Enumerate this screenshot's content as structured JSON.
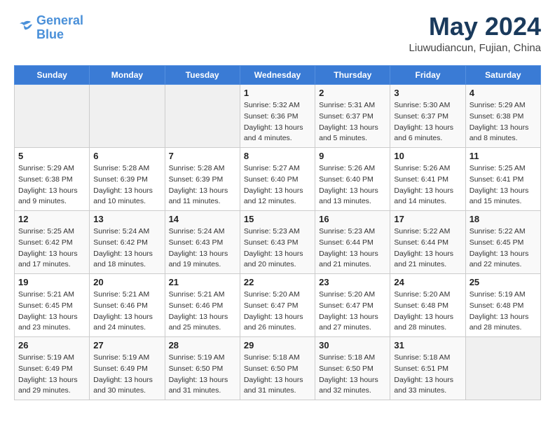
{
  "header": {
    "logo_line1": "General",
    "logo_line2": "Blue",
    "month_year": "May 2024",
    "location": "Liuwudiancun, Fujian, China"
  },
  "weekdays": [
    "Sunday",
    "Monday",
    "Tuesday",
    "Wednesday",
    "Thursday",
    "Friday",
    "Saturday"
  ],
  "weeks": [
    [
      {
        "day": "",
        "empty": true
      },
      {
        "day": "",
        "empty": true
      },
      {
        "day": "",
        "empty": true
      },
      {
        "day": "1",
        "sunrise": "5:32 AM",
        "sunset": "6:36 PM",
        "daylight": "13 hours and 4 minutes."
      },
      {
        "day": "2",
        "sunrise": "5:31 AM",
        "sunset": "6:37 PM",
        "daylight": "13 hours and 5 minutes."
      },
      {
        "day": "3",
        "sunrise": "5:30 AM",
        "sunset": "6:37 PM",
        "daylight": "13 hours and 6 minutes."
      },
      {
        "day": "4",
        "sunrise": "5:29 AM",
        "sunset": "6:38 PM",
        "daylight": "13 hours and 8 minutes."
      }
    ],
    [
      {
        "day": "5",
        "sunrise": "5:29 AM",
        "sunset": "6:38 PM",
        "daylight": "13 hours and 9 minutes."
      },
      {
        "day": "6",
        "sunrise": "5:28 AM",
        "sunset": "6:39 PM",
        "daylight": "13 hours and 10 minutes."
      },
      {
        "day": "7",
        "sunrise": "5:28 AM",
        "sunset": "6:39 PM",
        "daylight": "13 hours and 11 minutes."
      },
      {
        "day": "8",
        "sunrise": "5:27 AM",
        "sunset": "6:40 PM",
        "daylight": "13 hours and 12 minutes."
      },
      {
        "day": "9",
        "sunrise": "5:26 AM",
        "sunset": "6:40 PM",
        "daylight": "13 hours and 13 minutes."
      },
      {
        "day": "10",
        "sunrise": "5:26 AM",
        "sunset": "6:41 PM",
        "daylight": "13 hours and 14 minutes."
      },
      {
        "day": "11",
        "sunrise": "5:25 AM",
        "sunset": "6:41 PM",
        "daylight": "13 hours and 15 minutes."
      }
    ],
    [
      {
        "day": "12",
        "sunrise": "5:25 AM",
        "sunset": "6:42 PM",
        "daylight": "13 hours and 17 minutes."
      },
      {
        "day": "13",
        "sunrise": "5:24 AM",
        "sunset": "6:42 PM",
        "daylight": "13 hours and 18 minutes."
      },
      {
        "day": "14",
        "sunrise": "5:24 AM",
        "sunset": "6:43 PM",
        "daylight": "13 hours and 19 minutes."
      },
      {
        "day": "15",
        "sunrise": "5:23 AM",
        "sunset": "6:43 PM",
        "daylight": "13 hours and 20 minutes."
      },
      {
        "day": "16",
        "sunrise": "5:23 AM",
        "sunset": "6:44 PM",
        "daylight": "13 hours and 21 minutes."
      },
      {
        "day": "17",
        "sunrise": "5:22 AM",
        "sunset": "6:44 PM",
        "daylight": "13 hours and 21 minutes."
      },
      {
        "day": "18",
        "sunrise": "5:22 AM",
        "sunset": "6:45 PM",
        "daylight": "13 hours and 22 minutes."
      }
    ],
    [
      {
        "day": "19",
        "sunrise": "5:21 AM",
        "sunset": "6:45 PM",
        "daylight": "13 hours and 23 minutes."
      },
      {
        "day": "20",
        "sunrise": "5:21 AM",
        "sunset": "6:46 PM",
        "daylight": "13 hours and 24 minutes."
      },
      {
        "day": "21",
        "sunrise": "5:21 AM",
        "sunset": "6:46 PM",
        "daylight": "13 hours and 25 minutes."
      },
      {
        "day": "22",
        "sunrise": "5:20 AM",
        "sunset": "6:47 PM",
        "daylight": "13 hours and 26 minutes."
      },
      {
        "day": "23",
        "sunrise": "5:20 AM",
        "sunset": "6:47 PM",
        "daylight": "13 hours and 27 minutes."
      },
      {
        "day": "24",
        "sunrise": "5:20 AM",
        "sunset": "6:48 PM",
        "daylight": "13 hours and 28 minutes."
      },
      {
        "day": "25",
        "sunrise": "5:19 AM",
        "sunset": "6:48 PM",
        "daylight": "13 hours and 28 minutes."
      }
    ],
    [
      {
        "day": "26",
        "sunrise": "5:19 AM",
        "sunset": "6:49 PM",
        "daylight": "13 hours and 29 minutes."
      },
      {
        "day": "27",
        "sunrise": "5:19 AM",
        "sunset": "6:49 PM",
        "daylight": "13 hours and 30 minutes."
      },
      {
        "day": "28",
        "sunrise": "5:19 AM",
        "sunset": "6:50 PM",
        "daylight": "13 hours and 31 minutes."
      },
      {
        "day": "29",
        "sunrise": "5:18 AM",
        "sunset": "6:50 PM",
        "daylight": "13 hours and 31 minutes."
      },
      {
        "day": "30",
        "sunrise": "5:18 AM",
        "sunset": "6:50 PM",
        "daylight": "13 hours and 32 minutes."
      },
      {
        "day": "31",
        "sunrise": "5:18 AM",
        "sunset": "6:51 PM",
        "daylight": "13 hours and 33 minutes."
      },
      {
        "day": "",
        "empty": true
      }
    ]
  ],
  "labels": {
    "sunrise_prefix": "Sunrise: ",
    "sunset_prefix": "Sunset: ",
    "daylight_prefix": "Daylight: "
  }
}
